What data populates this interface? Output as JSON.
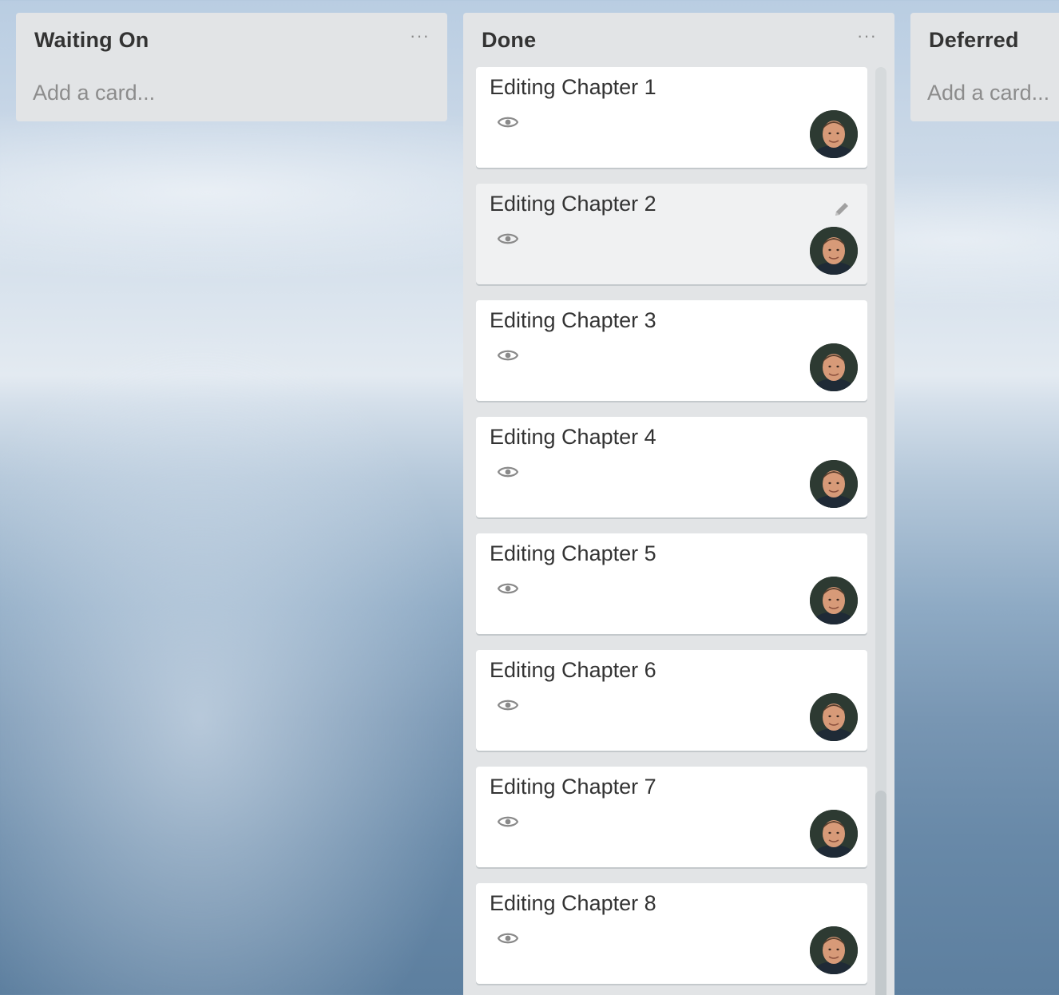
{
  "lists": {
    "waiting": {
      "title": "Waiting On",
      "menu_icon": "ellipsis-icon",
      "add_card": "Add a card..."
    },
    "done": {
      "title": "Done",
      "menu_icon": "ellipsis-icon",
      "cards": [
        {
          "title": "Editing Chapter 1",
          "badge_icon": "eye-icon",
          "member": "avatar"
        },
        {
          "title": "Editing Chapter 2",
          "badge_icon": "eye-icon",
          "member": "avatar",
          "hover_icon": "pencil-icon"
        },
        {
          "title": "Editing Chapter 3",
          "badge_icon": "eye-icon",
          "member": "avatar"
        },
        {
          "title": "Editing Chapter 4",
          "badge_icon": "eye-icon",
          "member": "avatar"
        },
        {
          "title": "Editing Chapter 5",
          "badge_icon": "eye-icon",
          "member": "avatar"
        },
        {
          "title": "Editing Chapter 6",
          "badge_icon": "eye-icon",
          "member": "avatar"
        },
        {
          "title": "Editing Chapter 7",
          "badge_icon": "eye-icon",
          "member": "avatar"
        },
        {
          "title": "Editing Chapter 8",
          "badge_icon": "eye-icon",
          "member": "avatar"
        }
      ]
    },
    "deferred": {
      "title": "Deferred",
      "add_card": "Add a card..."
    }
  },
  "colors": {
    "list_bg": "#e2e4e6",
    "card_bg": "#ffffff",
    "card_hover_bg": "#f0f1f2",
    "title_text": "#333333",
    "muted_text": "#8c8c8c"
  }
}
